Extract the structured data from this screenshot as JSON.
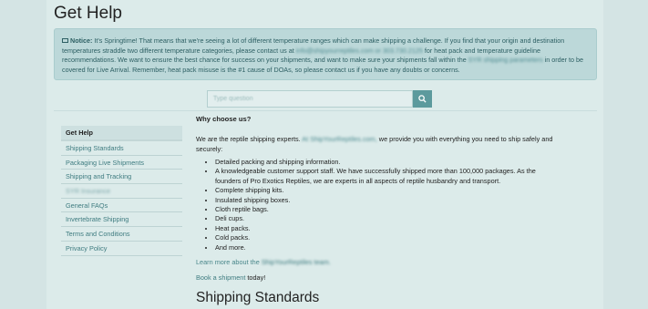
{
  "page": {
    "title": "Get Help"
  },
  "notice": {
    "label": "Notice:",
    "text1": "It's Springtime! That means that we're seeing a lot of different temperature ranges which can make shipping a challenge. If you find that your origin and destination temperatures straddle two different temperature categories, please contact us at",
    "contact": "info@shipyourreptiles.com or 303.730.2125",
    "text2": "for heat pack and temperature guideline recommendations. We want to ensure the best chance for success on your shipments, and want to make sure your shipments fall within the",
    "link": "SYR shipping parameters",
    "text3": "in order to be covered for Live Arrival. Remember, heat pack misuse is the #1 cause of DOAs, so please contact us if you have any doubts or concerns."
  },
  "search": {
    "placeholder": "Type question",
    "icon": "search-icon"
  },
  "sidebar": {
    "items": [
      {
        "label": "Get Help",
        "active": true
      },
      {
        "label": "Shipping Standards"
      },
      {
        "label": "Packaging Live Shipments"
      },
      {
        "label": "Shipping and Tracking"
      },
      {
        "label": "SYR Insurance",
        "blurred": true
      },
      {
        "label": "General FAQs"
      },
      {
        "label": "Invertebrate Shipping"
      },
      {
        "label": "Terms and Conditions"
      },
      {
        "label": "Privacy Policy"
      }
    ]
  },
  "main": {
    "heading": "Why choose us?",
    "intro_a": "We are the reptile shipping experts.",
    "intro_link": "At ShipYourReptiles.com,",
    "intro_b": "we provide you with everything you need to ship safely and securely:",
    "bullets": [
      "Detailed packing and shipping information.",
      "A knowledgeable customer support staff. We have successfully shipped more than 100,000 packages. As the founders of Pro Exotics Reptiles, we are experts in all aspects of reptile husbandry and transport.",
      "Complete shipping kits.",
      "Insulated shipping boxes.",
      "Cloth reptile bags.",
      "Deli cups.",
      "Heat packs.",
      "Cold packs.",
      "And more."
    ],
    "learn_text": "Learn more about the",
    "learn_link": "ShipYourReptiles team.",
    "book_link": "Book a shipment",
    "book_text": "today!"
  },
  "section2": {
    "title": "Shipping Standards"
  },
  "colors": {
    "accent": "#5c9a9d",
    "notice_bg": "#bcd8d9",
    "link": "#3f7c80"
  }
}
